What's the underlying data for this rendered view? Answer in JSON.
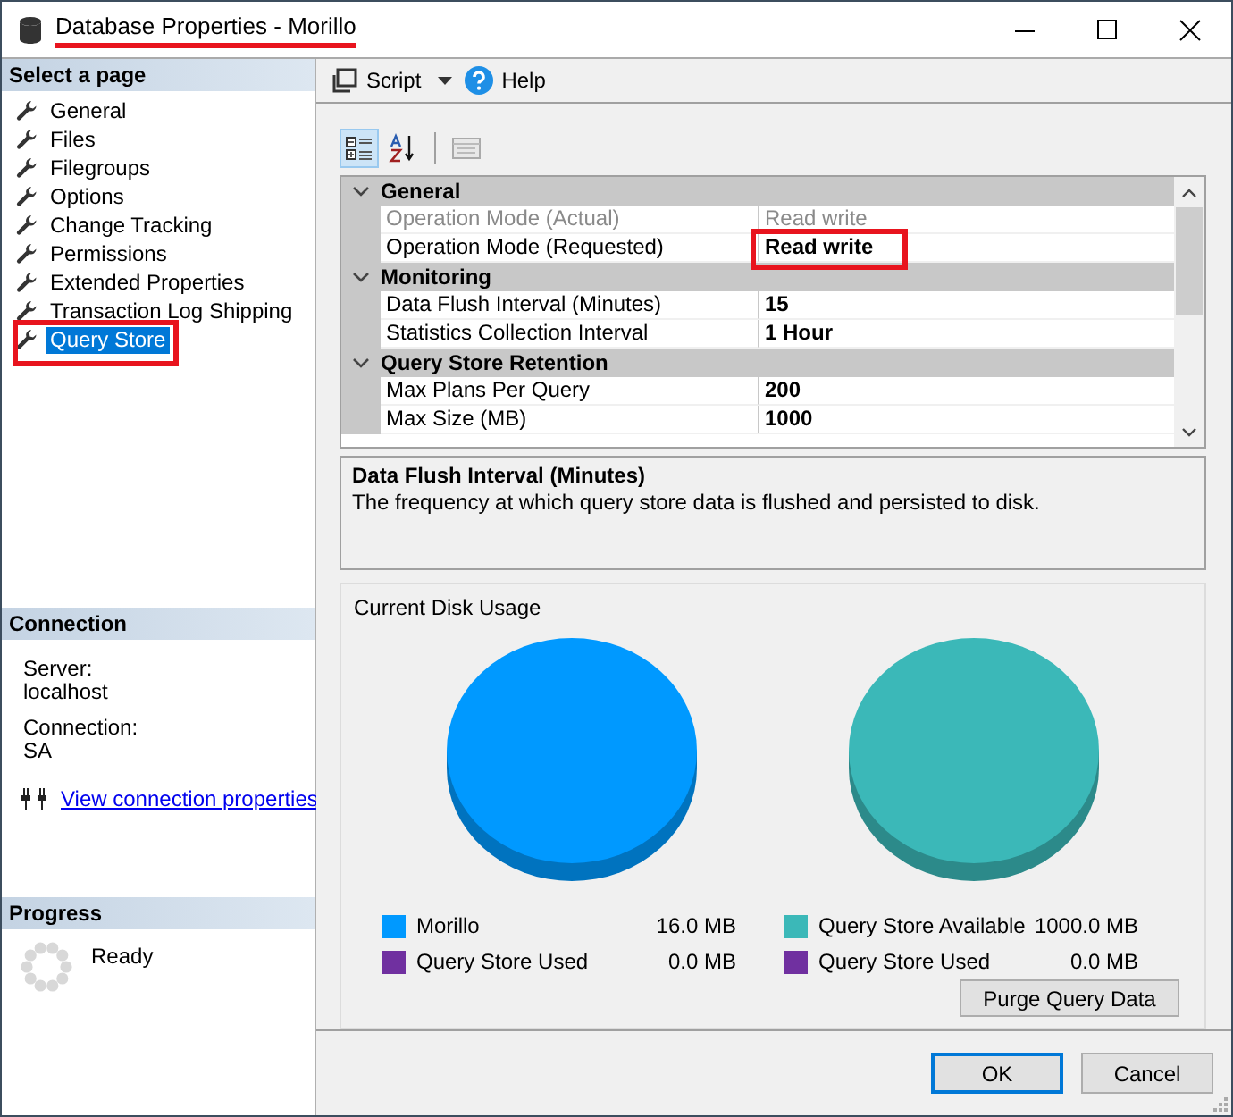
{
  "window": {
    "title": "Database Properties - Morillo",
    "title_annotated": true
  },
  "select_page": {
    "heading": "Select a page",
    "items": [
      {
        "label": "General",
        "selected": false,
        "annotated": false
      },
      {
        "label": "Files",
        "selected": false,
        "annotated": false
      },
      {
        "label": "Filegroups",
        "selected": false,
        "annotated": false
      },
      {
        "label": "Options",
        "selected": false,
        "annotated": false
      },
      {
        "label": "Change Tracking",
        "selected": false,
        "annotated": false
      },
      {
        "label": "Permissions",
        "selected": false,
        "annotated": false
      },
      {
        "label": "Extended Properties",
        "selected": false,
        "annotated": false
      },
      {
        "label": "Transaction Log Shipping",
        "selected": false,
        "annotated": false
      },
      {
        "label": "Query Store",
        "selected": true,
        "annotated": true
      }
    ]
  },
  "connection": {
    "heading": "Connection",
    "fields": [
      {
        "label": "Server:",
        "value": "localhost"
      },
      {
        "label": "Connection:",
        "value": "SA"
      }
    ],
    "link": "View connection properties"
  },
  "progress": {
    "heading": "Progress",
    "status": "Ready"
  },
  "toolbar": {
    "script": "Script",
    "help": "Help"
  },
  "property_grid": {
    "views": [
      {
        "kind": "categorized",
        "selected": true
      },
      {
        "kind": "alphabetical",
        "selected": false
      }
    ],
    "categories": [
      {
        "name": "General",
        "expanded": true,
        "properties": [
          {
            "name": "Operation Mode (Actual)",
            "value": "Read write",
            "disabled": true,
            "annotated": false
          },
          {
            "name": "Operation Mode (Requested)",
            "value": "Read write",
            "disabled": false,
            "annotated": true
          }
        ]
      },
      {
        "name": "Monitoring",
        "expanded": true,
        "properties": [
          {
            "name": "Data Flush Interval (Minutes)",
            "value": "15",
            "disabled": false,
            "annotated": false
          },
          {
            "name": "Statistics Collection Interval",
            "value": "1 Hour",
            "disabled": false,
            "annotated": false
          }
        ]
      },
      {
        "name": "Query Store Retention",
        "expanded": true,
        "properties": [
          {
            "name": "Max Plans Per Query",
            "value": "200",
            "disabled": false,
            "annotated": false
          },
          {
            "name": "Max Size (MB)",
            "value": "1000",
            "disabled": false,
            "annotated": false
          }
        ]
      }
    ]
  },
  "description": {
    "title": "Data Flush Interval (Minutes)",
    "text": "The frequency at which query store data is flushed and persisted to disk."
  },
  "disk_usage": {
    "title": "Current Disk Usage",
    "pies": [
      {
        "legend": [
          {
            "label": "Morillo",
            "value": "16.0 MB",
            "color": "#0099ff"
          },
          {
            "label": "Query Store Used",
            "value": "0.0 MB",
            "color": "#7030a0"
          }
        ]
      },
      {
        "legend": [
          {
            "label": "Query Store Available",
            "value": "1000.0 MB",
            "color": "#3bb8b8"
          },
          {
            "label": "Query Store Used",
            "value": "0.0 MB",
            "color": "#7030a0"
          }
        ]
      }
    ],
    "purge_button": "Purge Query Data"
  },
  "buttons": [
    {
      "label": "OK",
      "default": true
    },
    {
      "label": "Cancel",
      "default": false
    }
  ]
}
